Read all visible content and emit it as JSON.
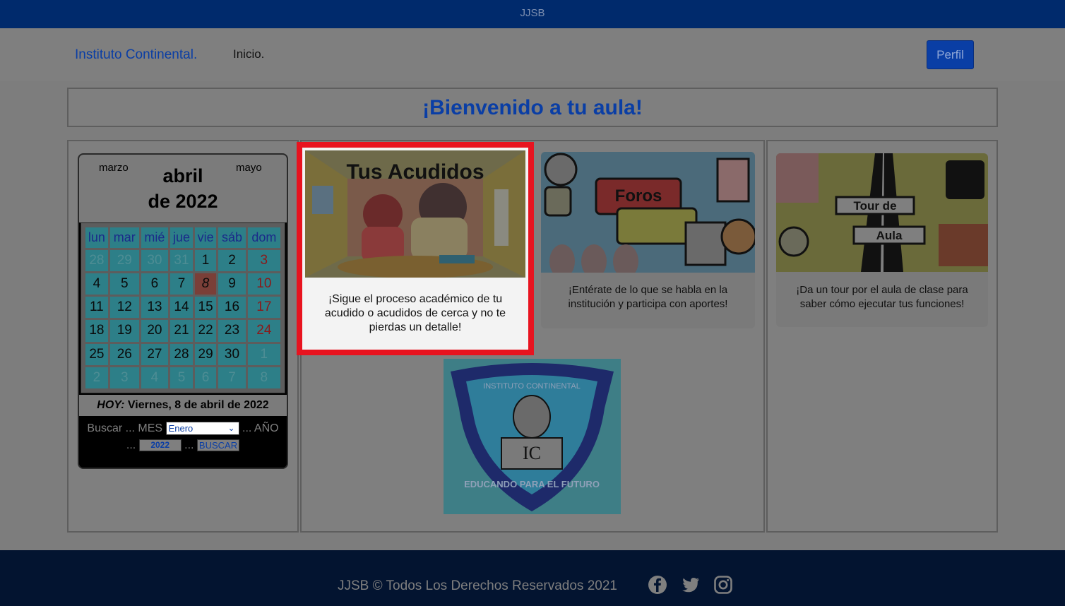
{
  "topbar": {
    "title": "JJSB"
  },
  "nav": {
    "brand": "Instituto Continental.",
    "inicio": "Inicio.",
    "perfil": "Perfil"
  },
  "welcome": {
    "title": "¡Bienvenido a tu aula!"
  },
  "calendar": {
    "prev_month": "marzo",
    "next_month": "mayo",
    "month": "abril",
    "year_line": "de 2022",
    "weekdays": [
      "lun",
      "mar",
      "mié",
      "jue",
      "vie",
      "sáb",
      "dom"
    ],
    "weeks": [
      [
        "28",
        "29",
        "30",
        "31",
        "1",
        "2",
        "3"
      ],
      [
        "4",
        "5",
        "6",
        "7",
        "8",
        "9",
        "10"
      ],
      [
        "11",
        "12",
        "13",
        "14",
        "15",
        "16",
        "17"
      ],
      [
        "18",
        "19",
        "20",
        "21",
        "22",
        "23",
        "24"
      ],
      [
        "25",
        "26",
        "27",
        "28",
        "29",
        "30",
        "1"
      ],
      [
        "2",
        "3",
        "4",
        "5",
        "6",
        "7",
        "8"
      ]
    ],
    "today_label": "HOY:",
    "today_value": "Viernes, 8 de abril de 2022",
    "search_label": "Buscar ... MES",
    "month_select": "Enero",
    "year_label": "... AÑO",
    "year_prefix": "...",
    "year_input": "2022",
    "button_prefix": "...",
    "search_button": "BUSCAR"
  },
  "cards": {
    "acudidos": {
      "image_title": "Tus Acudidos",
      "text": "¡Sigue el proceso académico de tu acudido o acudidos de cerca y no te pierdas un detalle!"
    },
    "foros": {
      "image_title": "Foros",
      "text": "¡Entérate de lo que se habla en la institución y participa con aportes!"
    },
    "tour": {
      "image_title_1": "Tour de",
      "image_title_2": "Aula",
      "text": "¡Da un tour por el aula de clase para saber cómo ejecutar tus funciones!"
    }
  },
  "logo": {
    "top_text": "INSTITUTO CONTINENTAL",
    "bottom_text": "EDUCANDO PARA EL FUTURO",
    "initials": "IC"
  },
  "footer": {
    "text": "JJSB © Todos Los Derechos Reservados 2021"
  },
  "colors": {
    "brand_blue": "#0a3ea5",
    "highlight_red": "#e8131f",
    "topbar": "#002a6c",
    "footer": "#031430"
  }
}
